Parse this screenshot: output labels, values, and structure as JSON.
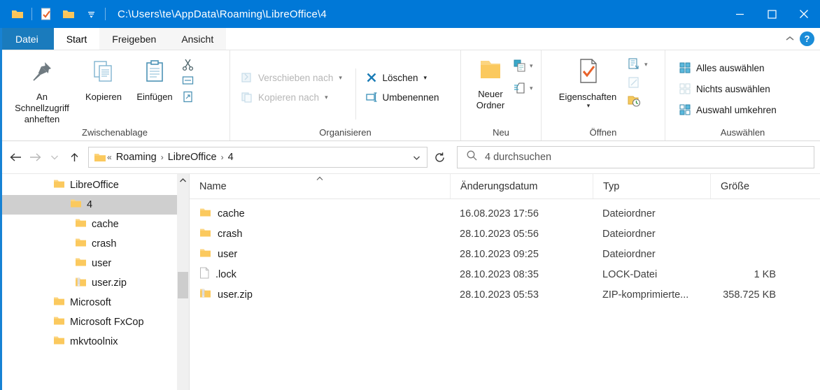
{
  "window": {
    "title": "C:\\Users\\te\\AppData\\Roaming\\LibreOffice\\4",
    "accent_color": "#0078d7",
    "minimize_label": "Minimieren",
    "maximize_label": "Maximieren",
    "close_label": "Schließen"
  },
  "quick_access": {
    "items": [
      {
        "icon": "folder-icon",
        "name": "explorer-icon"
      },
      {
        "icon": "properties-icon",
        "name": "properties-icon"
      },
      {
        "icon": "new-folder-icon",
        "name": "new-folder-icon"
      },
      {
        "icon": "chevron-down-icon",
        "name": "customize-qat-icon"
      }
    ]
  },
  "tabs": [
    {
      "id": "datei",
      "label": "Datei",
      "state": "file"
    },
    {
      "id": "start",
      "label": "Start",
      "state": "active"
    },
    {
      "id": "freigeben",
      "label": "Freigeben",
      "state": "inactive"
    },
    {
      "id": "ansicht",
      "label": "Ansicht",
      "state": "inactive"
    }
  ],
  "tabstrip_right": {
    "collapse_icon": "chevron-up-icon",
    "help_label": "?"
  },
  "ribbon": {
    "groups": [
      {
        "id": "zwischenablage",
        "label": "Zwischenablage",
        "big_buttons": [
          {
            "label": "An Schnellzugriff anheften",
            "icon": "pin-icon"
          },
          {
            "label": "Kopieren",
            "icon": "copy-icon"
          },
          {
            "label": "Einfügen",
            "icon": "paste-icon"
          }
        ],
        "small_icons": [
          {
            "name": "cut-icon",
            "label": "Ausschneiden"
          },
          {
            "name": "copy-path-icon",
            "label": "Pfad kopieren"
          },
          {
            "name": "paste-shortcut-icon",
            "label": "Verknüpfung einfügen"
          }
        ]
      },
      {
        "id": "organisieren",
        "label": "Organisieren",
        "left_items": [
          {
            "label": "Verschieben nach",
            "icon": "move-to-icon",
            "dimmed": true,
            "caret": true
          },
          {
            "label": "Kopieren nach",
            "icon": "copy-to-icon",
            "dimmed": true,
            "caret": true
          }
        ],
        "right_items": [
          {
            "label": "Löschen",
            "icon": "delete-icon",
            "dimmed": false,
            "caret": true
          },
          {
            "label": "Umbenennen",
            "icon": "rename-icon",
            "dimmed": false,
            "caret": false
          }
        ]
      },
      {
        "id": "neu",
        "label": "Neu",
        "big_buttons": [
          {
            "label": "Neuer Ordner",
            "icon": "new-folder-big-icon"
          }
        ],
        "small_icons": [
          {
            "name": "new-item-icon",
            "label": "Neues Element"
          },
          {
            "name": "easy-access-icon",
            "label": "Einfacher Zugriff"
          }
        ]
      },
      {
        "id": "oeffnen",
        "label": "Öffnen",
        "big_buttons": [
          {
            "label": "Eigenschaften",
            "icon": "properties-big-icon",
            "caret": true
          }
        ],
        "small_icons": [
          {
            "name": "open-with-icon",
            "label": "Öffnen mit"
          },
          {
            "name": "edit-icon",
            "label": "Bearbeiten"
          },
          {
            "name": "history-icon",
            "label": "Verlauf"
          }
        ]
      },
      {
        "id": "auswaehlen",
        "label": "Auswählen",
        "items": [
          {
            "label": "Alles auswählen",
            "icon": "select-all-icon"
          },
          {
            "label": "Nichts auswählen",
            "icon": "select-none-icon"
          },
          {
            "label": "Auswahl umkehren",
            "icon": "invert-selection-icon"
          }
        ]
      }
    ]
  },
  "addressbar": {
    "back_icon": "arrow-left-icon",
    "forward_icon": "arrow-right-icon",
    "recent_icon": "chevron-down-icon",
    "up_icon": "arrow-up-icon",
    "folder_icon": "folder-icon",
    "overflow": "«",
    "crumbs": [
      "Roaming",
      "LibreOffice",
      "4"
    ],
    "separator": "›",
    "dropdown_icon": "chevron-down-icon",
    "refresh_icon": "refresh-icon"
  },
  "search": {
    "icon": "search-icon",
    "placeholder": "4 durchsuchen",
    "value": ""
  },
  "navigation_tree": {
    "items": [
      {
        "label": "LibreOffice",
        "indent": 0,
        "icon": "folder-icon",
        "selected": false
      },
      {
        "label": "4",
        "indent": 1,
        "icon": "folder-icon",
        "selected": true
      },
      {
        "label": "cache",
        "indent": 2,
        "icon": "folder-icon",
        "selected": false
      },
      {
        "label": "crash",
        "indent": 2,
        "icon": "folder-icon",
        "selected": false
      },
      {
        "label": "user",
        "indent": 2,
        "icon": "folder-icon",
        "selected": false
      },
      {
        "label": "user.zip",
        "indent": 2,
        "icon": "zip-icon",
        "selected": false
      },
      {
        "label": "Microsoft",
        "indent": 0,
        "icon": "folder-icon",
        "selected": false
      },
      {
        "label": "Microsoft FxCop",
        "indent": 0,
        "icon": "folder-icon",
        "selected": false
      },
      {
        "label": "mkvtoolnix",
        "indent": 0,
        "icon": "folder-icon",
        "selected": false
      }
    ],
    "scrollbar": {
      "up_icon": "chevron-up-icon",
      "thumb_top_pct": 44,
      "thumb_height_pct": 12
    }
  },
  "file_list": {
    "columns": [
      {
        "key": "name",
        "label": "Name",
        "sorted": "asc"
      },
      {
        "key": "date",
        "label": "Änderungsdatum",
        "sorted": ""
      },
      {
        "key": "type",
        "label": "Typ",
        "sorted": ""
      },
      {
        "key": "size",
        "label": "Größe",
        "sorted": ""
      }
    ],
    "rows": [
      {
        "icon": "folder-icon",
        "name": "cache",
        "date": "16.08.2023 17:56",
        "type": "Dateiordner",
        "size": ""
      },
      {
        "icon": "folder-icon",
        "name": "crash",
        "date": "28.10.2023 05:56",
        "type": "Dateiordner",
        "size": ""
      },
      {
        "icon": "folder-icon",
        "name": "user",
        "date": "28.10.2023 09:25",
        "type": "Dateiordner",
        "size": ""
      },
      {
        "icon": "file-icon",
        "name": ".lock",
        "date": "28.10.2023 08:35",
        "type": "LOCK-Datei",
        "size": "1 KB"
      },
      {
        "icon": "zip-icon",
        "name": "user.zip",
        "date": "28.10.2023 05:53",
        "type": "ZIP-komprimierte...",
        "size": "358.725 KB"
      }
    ]
  }
}
